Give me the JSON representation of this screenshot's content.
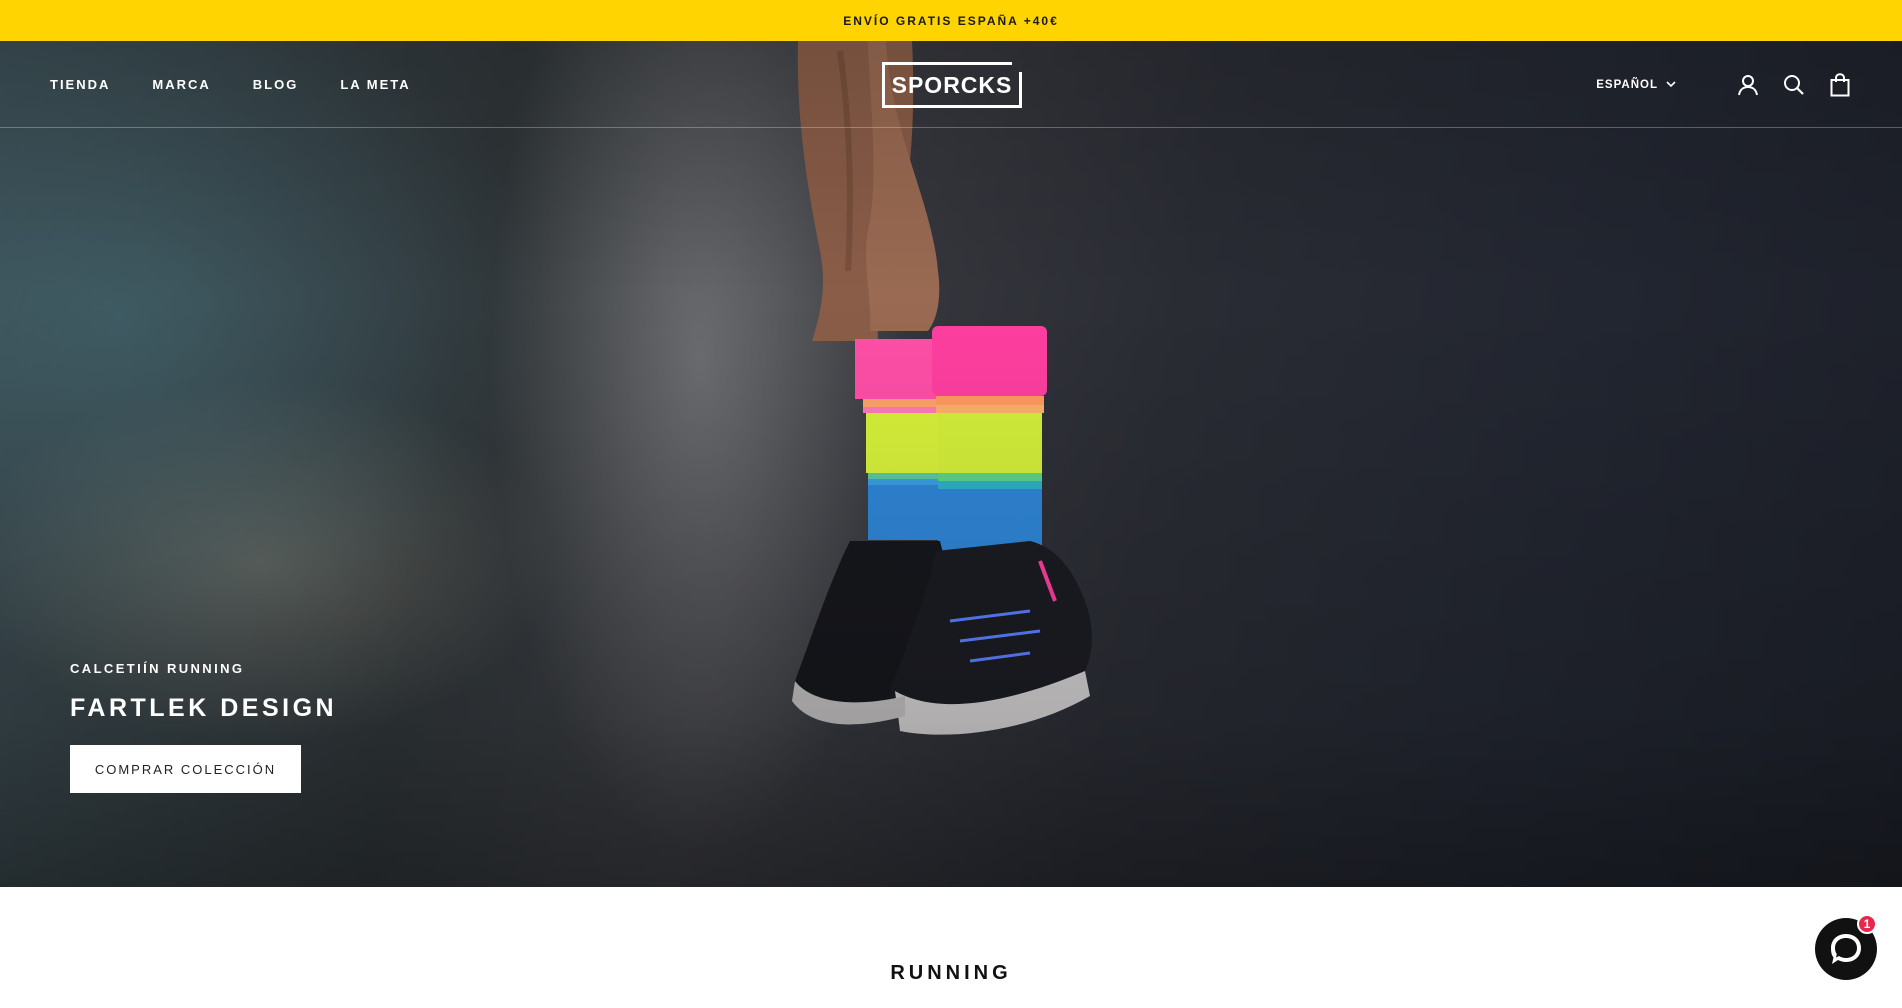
{
  "announcement": {
    "text": "ENVÍO GRATIS ESPAÑA +40€"
  },
  "header": {
    "logo_text": "SPORCKS",
    "nav": [
      "TIENDA",
      "MARCA",
      "BLOG",
      "LA META"
    ],
    "language": "ESPAÑOL",
    "icons": [
      "user-icon",
      "search-icon",
      "bag-icon"
    ]
  },
  "hero": {
    "eyebrow": "CALCETIÍN RUNNING",
    "title": "FARTLEK DESIGN",
    "cta_label": "COMPRAR COLECCIÓN"
  },
  "section": {
    "title": "RUNNING"
  },
  "chat": {
    "badge_count": "1"
  },
  "colors": {
    "announcement_bg": "#ffd400",
    "sock_pink": "#ff4fa8",
    "sock_lime": "#d8f23a",
    "sock_blue": "#2f86d8",
    "chat_badge": "#e8274b"
  }
}
